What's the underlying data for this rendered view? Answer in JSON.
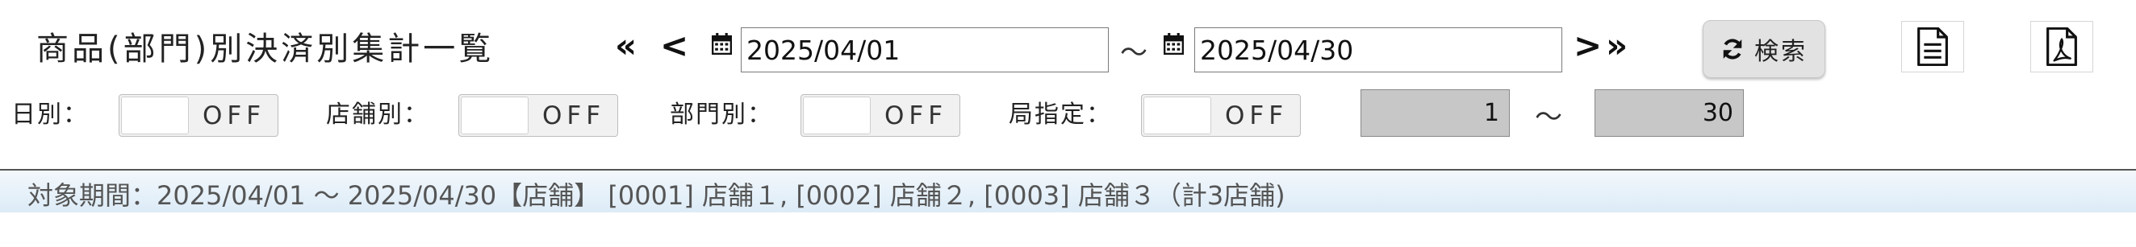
{
  "header": {
    "title": "商品(部門)別決済別集計一覧",
    "nav": {
      "first_label": "«",
      "prev_label": "<",
      "next_label": ">",
      "last_label": "»"
    },
    "date_range": {
      "start": "2025/04/01",
      "separator": "～",
      "end": "2025/04/30"
    },
    "search_button_label": "検索",
    "icons": [
      "calendar-icon",
      "refresh-icon",
      "document-icon",
      "pdf-icon"
    ]
  },
  "filters": {
    "toggles": [
      {
        "label": "日別：",
        "state": "OFF"
      },
      {
        "label": "店舗別：",
        "state": "OFF"
      },
      {
        "label": "部門別：",
        "state": "OFF"
      },
      {
        "label": "局指定：",
        "state": "OFF"
      }
    ],
    "range_from": "1",
    "range_separator": "～",
    "range_to": "30"
  },
  "summary": {
    "text": "対象期間：2025/04/01 ～ 2025/04/30【店舗】 [0001] 店舗１, [0002] 店舗２, [0003] 店舗３（計3店舗)"
  }
}
